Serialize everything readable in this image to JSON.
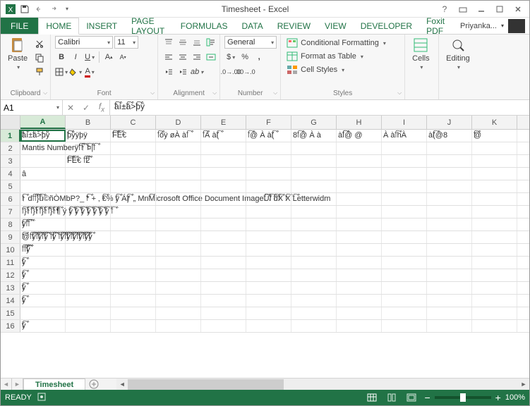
{
  "title": "Timesheet - Excel",
  "user": "Priyanka...",
  "tabs": [
    "FILE",
    "HOME",
    "INSERT",
    "PAGE LAYOUT",
    "FORMULAS",
    "DATA",
    "REVIEW",
    "VIEW",
    "DEVELOPER",
    "Foxit PDF"
  ],
  "active_tab": "HOME",
  "ribbon": {
    "clipboard": {
      "label": "Clipboard",
      "paste": "Paste"
    },
    "font": {
      "label": "Font",
      "name": "Calibri",
      "size": "11"
    },
    "alignment": {
      "label": "Alignment"
    },
    "number": {
      "label": "Number",
      "format": "General"
    },
    "styles": {
      "label": "Styles",
      "cond": "Conditional Formatting",
      "table": "Format as Table",
      "cell": "Cell Styles"
    },
    "cells": {
      "label": "Cells",
      "btn": "Cells"
    },
    "editing": {
      "label": "Editing",
      "btn": "Editing"
    }
  },
  "namebox": "A1",
  "formula": "￯àí±￯á>￯þÿ",
  "columns": [
    "A",
    "B",
    "C",
    "D",
    "E",
    "F",
    "G",
    "H",
    "I",
    "J",
    "K"
  ],
  "selected_col": "A",
  "rows": [
    {
      "n": "1",
      "sel": true,
      "cells": [
        "￯àí±￯á>￯þÿ",
        "￯￯þÿÿþÿ",
        "￯￯F￯É€",
        "￯ őÿ øÀ à￯",
        "￯ À à￯(",
        "￯ @ À à￯(",
        "8￯ @ À à",
        "à￯￯ @ @",
        "À à￯ hÀ",
        "à￯(@8",
        "￯@"
      ]
    },
    {
      "n": "2",
      "cells": [
        "Mantis Numberÿ￯ˆ￯↑ ￯¤|￯"
      ]
    },
    {
      "n": "3",
      "cells": [
        "",
        "￯￯F￯É€ ￯ ￯2"
      ]
    },
    {
      "n": "4",
      "cells": [
        "â"
      ]
    },
    {
      "n": "5",
      "cells": [
        ""
      ]
    },
    {
      "n": "6",
      "cells": [
        "￯↑ d￯ ￯ }￯ü©ñÒMbP?_ ￯* + ‚ ￯€% ￯ÿ Á￯ƒ „ Mn￯Microsoft Office Document Image￯￯Ü￯/ ￯d￯X   ￯X ￯Letterwidm"
      ]
    },
    {
      "n": "7",
      "cells": [
        "￯ }￯↑￯ }￯↑￯ }￯↑￯ }￯↑￯¶ ý ￯￯ý ￯￯ý ￯￯ý ￯￯ý ￯￯ý ￯￯ý ￯￯ý ￯"
      ]
    },
    {
      "n": "8",
      "cells": [
        "￯ÿ￯ ￯"
      ]
    },
    {
      "n": "9",
      "cells": [
        "￯@￯ ￯￯ý￯ ￯￯ý￯ ￯￯ý ￯ ￯￯ý ￯ ￯￯ý￯ ￯￯ý￯ ￯￯ý￯ ￯￯ý￯ ￯￯ý￯ý"
      ]
    },
    {
      "n": "10",
      "cells": [
        "￯ ￯ ￯￯ý"
      ]
    },
    {
      "n": "11",
      "cells": [
        "￯ý"
      ]
    },
    {
      "n": "12",
      "cells": [
        "￯ý"
      ]
    },
    {
      "n": "13",
      "cells": [
        "￯ý"
      ]
    },
    {
      "n": "14",
      "cells": [
        "￯ý"
      ]
    },
    {
      "n": "15",
      "cells": [
        ""
      ]
    },
    {
      "n": "16",
      "cells": [
        "￯ý"
      ]
    }
  ],
  "sheet": "Timesheet",
  "status": {
    "ready": "READY",
    "zoom": "100%"
  }
}
